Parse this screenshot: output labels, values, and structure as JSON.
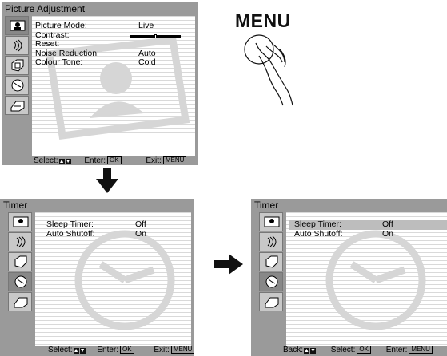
{
  "picture_adjustment": {
    "title": "Picture Adjustment",
    "rows": [
      {
        "label": "Picture Mode:",
        "value": "Live"
      },
      {
        "label": "Contrast:",
        "value": ""
      },
      {
        "label": "Reset:",
        "value": ""
      },
      {
        "label": "Noise Reduction:",
        "value": "Auto"
      },
      {
        "label": "Colour Tone:",
        "value": "Cold"
      }
    ],
    "contrast_level": 0.5,
    "footer": {
      "select": "Select:",
      "enter": "Enter:",
      "enter_key": "OK",
      "exit": "Exit:",
      "exit_key": "MENU"
    }
  },
  "menu_instruction": {
    "label": "MENU"
  },
  "timer_screen_1": {
    "title": "Timer",
    "rows": [
      {
        "label": "Sleep Timer:",
        "value": "Off"
      },
      {
        "label": "Auto Shutoff:",
        "value": "On"
      }
    ],
    "footer": {
      "select": "Select:",
      "enter": "Enter:",
      "enter_key": "OK",
      "exit": "Exit:",
      "exit_key": "MENU"
    }
  },
  "timer_screen_2": {
    "title": "Timer",
    "rows": [
      {
        "label": "Sleep Timer:",
        "value": "Off"
      },
      {
        "label": "Auto Shutoff:",
        "value": "On"
      }
    ],
    "highlighted_row": 0,
    "footer": {
      "back": "Back:",
      "select": "Select:",
      "select_key": "OK",
      "enter": "Enter:",
      "enter_key": "MENU"
    }
  },
  "icons": [
    "picture-icon",
    "sound-icon",
    "features-icon",
    "timer-icon",
    "setup-icon"
  ],
  "colors": {
    "frame": "#9a9a9a",
    "panel": "#ffffff",
    "highlight": "#bdbdbd",
    "arrow": "#111111"
  }
}
